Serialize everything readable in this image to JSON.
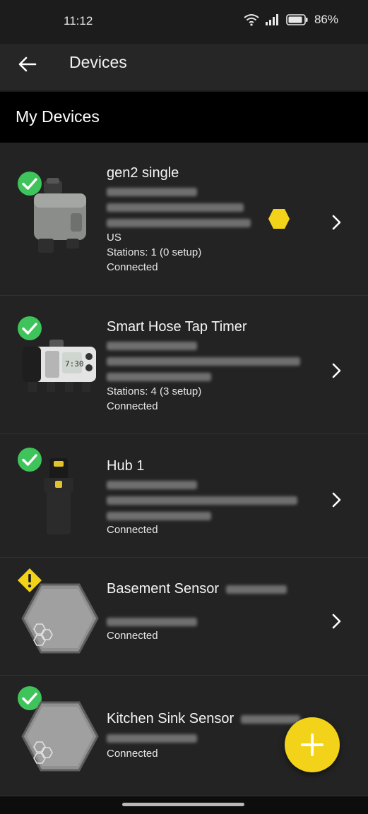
{
  "status_bar": {
    "time": "11:12",
    "battery": "86%"
  },
  "app_bar": {
    "title": "Devices"
  },
  "section": {
    "title": "My Devices"
  },
  "devices": [
    {
      "name": "gen2 single",
      "country": "US",
      "stations": "Stations: 1 (0 setup)",
      "status": "Connected",
      "badge": "ok"
    },
    {
      "name": "Smart Hose Tap Timer",
      "stations": "Stations: 4 (3 setup)",
      "status": "Connected",
      "badge": "ok"
    },
    {
      "name": "Hub 1",
      "status": "Connected",
      "badge": "ok"
    },
    {
      "name": "Basement Sensor",
      "status": "Connected",
      "badge": "warning"
    },
    {
      "name": "Kitchen Sink Sensor",
      "status": "Connected",
      "badge": "ok"
    }
  ],
  "colors": {
    "ok": "#3ec45a",
    "warning": "#f2d31a",
    "fab": "#f2d31a"
  },
  "icons": [
    "back-arrow-icon",
    "wifi-icon",
    "signal-icon",
    "battery-icon",
    "check-icon",
    "warning-icon",
    "chevron-right-icon",
    "plus-icon"
  ]
}
